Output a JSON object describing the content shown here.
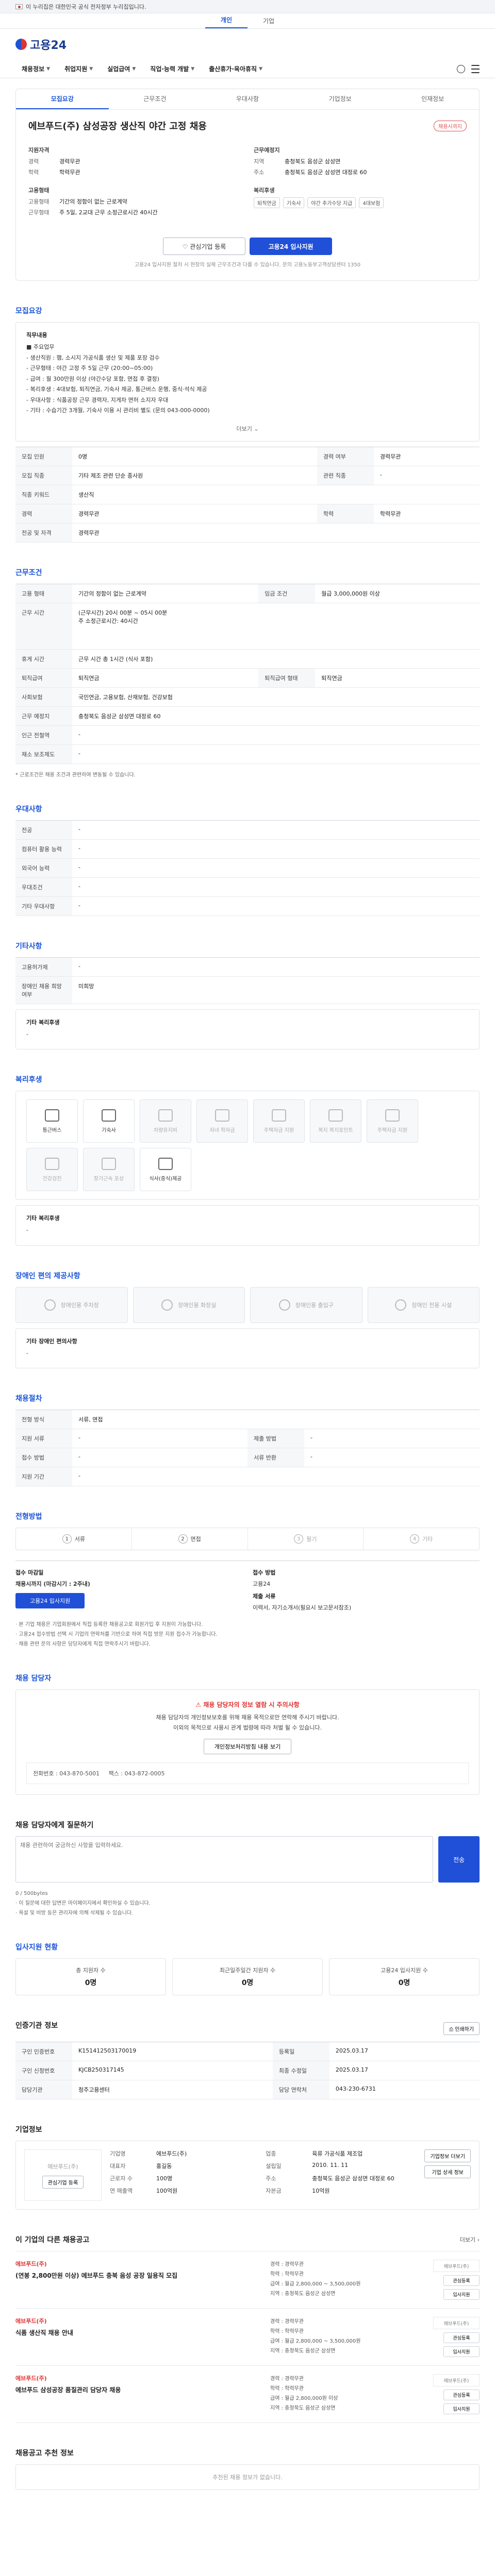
{
  "gov_banner": "이 누리집은 대한민국 공식 전자정부 누리집입니다.",
  "auth_tabs": [
    "개인",
    "기업"
  ],
  "logo": "고용24",
  "main_nav": [
    "채용정보",
    "취업지원",
    "실업급여",
    "직업·능력 개발",
    "출산휴가·육아휴직"
  ],
  "job": {
    "tabs": [
      "모집요강",
      "근무조건",
      "우대사항",
      "기업정보",
      "인재정보"
    ],
    "title": "에브푸드(주) 삼성공장 생산직 야간 고정 채용",
    "deadline_badge": "채용시까지",
    "left_heading": "지원자격",
    "right_heading": "근무예정지",
    "left_lines": [
      {
        "k": "경력",
        "v": "경력무관"
      },
      {
        "k": "학력",
        "v": "학력무관"
      }
    ],
    "right_lines": [
      {
        "k": "지역",
        "v": "충청북도 음성군 삼성면"
      },
      {
        "k": "주소",
        "v": "충청북도 음성군 삼성면 대정로 60"
      }
    ],
    "left2_heading": "고용형태",
    "left2_lines": [
      {
        "k": "고용형태",
        "v": "기간의 정함이 없는 근로계약"
      },
      {
        "k": "근무형태",
        "v": "주 5일, 2교대 근무 소정근로시간 40시간"
      }
    ],
    "right2_heading": "복리후생",
    "chips": [
      "퇴직연금",
      "기숙사",
      "야간 추가수당 지급",
      "4대보험"
    ],
    "btn_interest": "관심기업 등록",
    "btn_apply": "고용24 입사지원",
    "notice": "고용24 입사지원 절차 시 현장의 실제 근무조건과 다를 수 있습니다. 문의 고용노동부고객상담센터 1350"
  },
  "recruit": {
    "title": "모집요강",
    "box_heading": "직무내용",
    "lines": [
      "■ 주요업무",
      "- 생산직원 : 햄, 소시지 가공식품 생산 및 제품 포장 검수",
      "- 근무형태 : 야간 고정 주 5일 근무 (20:00~05:00)",
      "- 급여 : 월 300만원 이상 (야간수당 포함, 면접 후 결정)",
      "- 복리후생 : 4대보험, 퇴직연금, 기숙사 제공, 통근버스 운행, 중식·석식 제공",
      "- 우대사항 : 식품공장 근무 경력자, 지게차 면허 소지자 우대",
      "- 기타 : 수습기간 3개월, 기숙사 이용 시 관리비 별도 (문의 043-000-0000)"
    ],
    "more": "더보기",
    "rows": [
      {
        "k": "모집 인원",
        "v": "0명",
        "k2": "경력 여부",
        "v2": "경력무관"
      },
      {
        "k": "모집 직종",
        "v": "기타 제조 관련 단순 종사원",
        "k2": "관련 직종",
        "v2": "-"
      },
      {
        "k": "직종 키워드",
        "v": "생산직",
        "k2": "",
        "v2": ""
      },
      {
        "k": "경력",
        "v": "경력무관",
        "k2": "학력",
        "v2": "학력무관"
      },
      {
        "k": "전공 및 자격",
        "v": "경력무관",
        "k2": "",
        "v2": ""
      }
    ]
  },
  "conditions": {
    "title": "근무조건",
    "rows": [
      {
        "k": "고용 형태",
        "v": "기간의 정함이 없는 근로계약",
        "k2": "임금 조건",
        "v2": "월급 3,000,000원 이상"
      },
      {
        "k": "근무 시간",
        "v": "(근무시간) 20시 00분 ~ 05시 00분\n주 소정근로시간: 40시간",
        "k2": "",
        "v2": ""
      },
      {
        "k": "휴게 시간",
        "v": "근무 시간 총 1시간 (식사 포함)",
        "k2": "",
        "v2": ""
      },
      {
        "k": "퇴직급여",
        "v": "퇴직연금",
        "k2": "퇴직급여 형태",
        "v2": "퇴직연금"
      },
      {
        "k": "사회보험",
        "v": "국민연금, 고용보험, 산재보험, 건강보험",
        "k2": "",
        "v2": ""
      },
      {
        "k": "근무 예정지",
        "v": "충청북도 음성군 삼성면 대정로 60",
        "k2": "",
        "v2": ""
      },
      {
        "k": "인근 전철역",
        "v": "-",
        "k2": "",
        "v2": ""
      },
      {
        "k": "채소 보조제도",
        "v": "-",
        "k2": "",
        "v2": ""
      }
    ],
    "footnote": "* 근로조건은 채용 조건과 관련하여 변동될 수 있습니다."
  },
  "preference": {
    "title": "우대사항",
    "rows": [
      {
        "k": "전공",
        "v": "-"
      },
      {
        "k": "컴퓨터 활용 능력",
        "v": "-"
      },
      {
        "k": "외국어 능력",
        "v": "-"
      },
      {
        "k": "우대조건",
        "v": "-"
      },
      {
        "k": "기타 우대사항",
        "v": "-"
      }
    ]
  },
  "extra": {
    "title": "기타사항",
    "rows": [
      {
        "k": "고용허가제",
        "v": "-"
      },
      {
        "k": "장애인 채용 희망 여부",
        "v": "미희망"
      }
    ],
    "note_heading": "기타 복리후생",
    "note_value": "-"
  },
  "welfare": {
    "title": "복리후생",
    "items": [
      {
        "label": "통근버스",
        "on": true
      },
      {
        "label": "기숙사",
        "on": true
      },
      {
        "label": "차량유지비",
        "on": false
      },
      {
        "label": "자녀 학자금",
        "on": false
      },
      {
        "label": "주택자금 지원",
        "on": false
      },
      {
        "label": "복지 복지포인트",
        "on": false
      },
      {
        "label": "주택자금 지원",
        "on": false
      },
      {
        "label": "건강검진",
        "on": false
      },
      {
        "label": "장기근속 포상",
        "on": false
      },
      {
        "label": "식사(중식)제공",
        "on": true
      }
    ],
    "other_heading": "기타 복리후생",
    "other_value": "-"
  },
  "disability": {
    "title": "장애인 편의 제공사항",
    "items": [
      "장애인용 주차장",
      "장애인용 화장실",
      "장애인용 출입구",
      "장애인 전용 시설"
    ],
    "other_heading": "기타 장애인 편의사항",
    "other_value": "-"
  },
  "channel": {
    "title": "채용절차",
    "rows": [
      {
        "k": "전형 방식",
        "v": "서류, 면접"
      },
      {
        "k": "지원 서류",
        "v": "-",
        "k2": "제출 방법",
        "v2": "-"
      },
      {
        "k": "접수 방법",
        "v": "-",
        "k2": "서류 반환",
        "v2": "-"
      },
      {
        "k": "지원 기간",
        "v": "-",
        "k2": "",
        "v2": ""
      }
    ]
  },
  "process": {
    "title": "전형방법",
    "steps": [
      {
        "num": "1",
        "label": "서류",
        "on": true
      },
      {
        "num": "2",
        "label": "면접",
        "on": true
      },
      {
        "num": "3",
        "label": "필기",
        "on": false
      },
      {
        "num": "4",
        "label": "기타",
        "on": false
      }
    ],
    "apply_heading": "접수 마감일",
    "apply_value": "채용시까지 (마감시기 : 2주내)",
    "apply_btn": "고용24 입사지원",
    "method_heading": "접수 방법",
    "method_value": "고용24",
    "doc_heading": "제출 서류",
    "doc_value": "이력서, 자기소개서(필요시 보고문서참조)",
    "notes": [
      "· 본 기업 채용은 기업회원에서 직접 등록한 채용공고로 회원가입 후 지원이 가능합니다.",
      "· 고용24 접수방법 선택 시 기업의 연락처를 기반으로 하여 직접 방문 지원 접수가 가능합니다.",
      "· 채용 관련 문의 사항은 담당자에게 직접 연락주시기 바랍니다."
    ]
  },
  "contact": {
    "title": "채용 담당자",
    "warn": "채용 담당자의 정보 열람 시 주의사항",
    "p1": "채용 담당자의 개인정보보호를 위해 채용 목적으로만 연락해 주시기 바랍니다.",
    "p2": "이외의 목적으로 사용시 관계 법령에 따라 처벌 될 수 있습니다.",
    "btn": "개인정보처리방침 내용 보기",
    "phone_label": "전화번호",
    "phone": "043-870-5001",
    "fax_label": "팩스",
    "fax": "043-872-0005"
  },
  "inquiry": {
    "title": "채용 담당자에게 질문하기",
    "placeholder": "채용 관련하여 궁금하신 사항을 입력하세요.",
    "count": "0 / 500bytes",
    "btn": "전송",
    "hint1": "· 이 질문에 대한 답변은 마이페이지에서 확인하실 수 있습니다.",
    "hint2": "· 욕설 및 비방 등은 관리자에 의해 삭제될 수 있습니다."
  },
  "status": {
    "title": "입사지원 현황",
    "cards": [
      {
        "lbl": "총 지원자 수",
        "num": "0명"
      },
      {
        "lbl": "최근일주일간 지원자 수",
        "num": "0명"
      },
      {
        "lbl": "고용24 입사지원 수",
        "num": "0명"
      }
    ]
  },
  "register": {
    "title": "인증기관 정보",
    "btn": "인쇄하기",
    "rows": [
      {
        "k": "구인 인증번호",
        "v": "K151412503170019",
        "k2": "등록일",
        "v2": "2025.03.17"
      },
      {
        "k": "구인 신청번호",
        "v": "KJCB250317145",
        "k2": "최종 수정일",
        "v2": "2025.03.17"
      },
      {
        "k": "담당기관",
        "v": "청주고용센터",
        "k2": "담당 연락처",
        "v2": "043-230-6731"
      }
    ]
  },
  "company": {
    "title": "기업정보",
    "logo_text": "에브푸드(주)",
    "btn_interest": "관심기업 등록",
    "info": [
      {
        "k": "기업명",
        "v": "에브푸드(주)"
      },
      {
        "k": "업종",
        "v": "육류 가공식품 제조업"
      },
      {
        "k": "대표자",
        "v": "홍길동"
      },
      {
        "k": "설립일",
        "v": "2010. 11. 11"
      },
      {
        "k": "근로자 수",
        "v": "100명"
      },
      {
        "k": "주소",
        "v": "충청북도 음성군 삼성면 대정로 60"
      },
      {
        "k": "연 매출액",
        "v": "100억원"
      },
      {
        "k": "자본금",
        "v": "10억원"
      }
    ],
    "side_btns": [
      "기업정보 더보기",
      "기업 상세 정보"
    ]
  },
  "related": {
    "title": "이 기업의 다른 채용공고",
    "more": "더보기",
    "items": [
      {
        "co": "에브푸드(주)",
        "title": "(연봉 2,800만원 이상) 에브푸드 충북 음성 공장 일용직 모집",
        "lines": [
          "경력 : 경력무관",
          "학력 : 학력무관",
          "급여 : 월급 2,800,000 ~ 3,500,000원",
          "지역 : 충청북도 음성군 삼성면"
        ],
        "logo": "에브푸드(주)"
      },
      {
        "co": "에브푸드(주)",
        "title": "식품 생산직 채용 안내",
        "lines": [
          "경력 : 경력무관",
          "학력 : 학력무관",
          "급여 : 월급 2,800,000 ~ 3,500,000원",
          "지역 : 충청북도 음성군 삼성면"
        ],
        "logo": "에브푸드(주)"
      },
      {
        "co": "에브푸드(주)",
        "title": "에브푸드 삼성공장 품질관리 담당자 채용",
        "lines": [
          "경력 : 경력무관",
          "학력 : 학력무관",
          "급여 : 월급 2,800,000원 이상",
          "지역 : 충청북도 음성군 삼성면"
        ],
        "logo": "에브푸드(주)"
      }
    ],
    "item_btns": [
      "관심등록",
      "입사지원"
    ]
  },
  "recommend": {
    "title": "채용공고 추천 정보",
    "empty": "추천된 채용 정보가 없습니다."
  }
}
